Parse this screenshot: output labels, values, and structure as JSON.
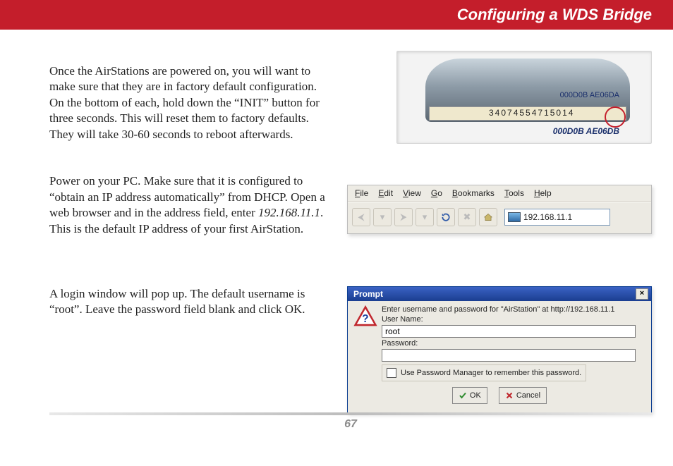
{
  "header": {
    "title": "Configuring a WDS Bridge"
  },
  "paragraphs": {
    "p1": "Once the AirStations are powered on, you will want to make sure that they are in factory default configuration.  On the bottom of each, hold down the “INIT” button for three seconds.  This will reset them to factory defaults.  They will take 30-60 seconds to reboot afterwards.",
    "p2a": "Power on your PC.  Make sure that it is configured to “obtain an IP address automatically” from DHCP.  Open a web browser and in the address field, enter ",
    "p2ip": "192.168.11.1",
    "p2b": ".  This is the default IP address of your first AirStation.",
    "p3": "A login window will pop up.  The default username is “root”.  Leave the password field blank and click OK."
  },
  "device": {
    "mac1": "000D0B AE06DA",
    "serial": "34074554715014",
    "mac2": "000D0B AE06DB"
  },
  "browser": {
    "menu": {
      "file": "File",
      "edit": "Edit",
      "view": "View",
      "go": "Go",
      "bookmarks": "Bookmarks",
      "tools": "Tools",
      "help": "Help"
    },
    "address": "192.168.11.1"
  },
  "dialog": {
    "title": "Prompt",
    "message": "Enter username and password for \"AirStation\" at http://192.168.11.1",
    "user_label": "User Name:",
    "user_value": "root",
    "pass_label": "Password:",
    "pass_value": "",
    "remember": "Use Password Manager to remember this password.",
    "ok": "OK",
    "cancel": "Cancel"
  },
  "page_number": "67"
}
